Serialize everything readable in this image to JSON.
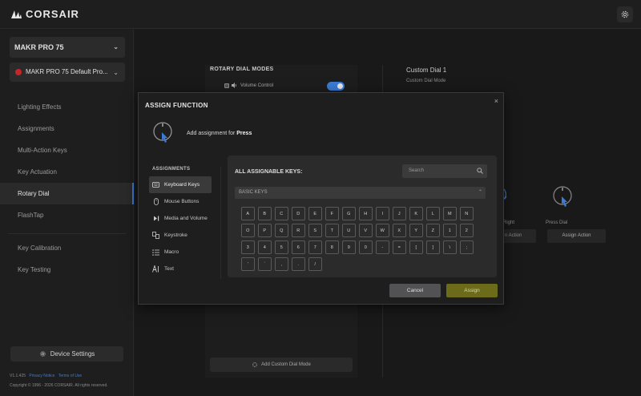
{
  "brand": {
    "name": "CORSAIR"
  },
  "sidebar": {
    "device": "MAKR PRO 75",
    "profile": "MAKR PRO 75 Default Pro...",
    "items": [
      {
        "label": "Lighting Effects",
        "active": false
      },
      {
        "label": "Assignments",
        "active": false
      },
      {
        "label": "Multi-Action Keys",
        "active": false
      },
      {
        "label": "Key Actuation",
        "active": false
      },
      {
        "label": "Rotary Dial",
        "active": true
      },
      {
        "label": "FlashTap",
        "active": false
      }
    ],
    "items2": [
      {
        "label": "Key Calibration"
      },
      {
        "label": "Key Testing"
      }
    ],
    "device_settings": "Device Settings",
    "version": "V1.1.425",
    "privacy": "Privacy Notice",
    "terms": "Terms of Use",
    "copyright": "Copyright © 1996 - 2026 CORSAIR. All rights reserved."
  },
  "main": {
    "rotary_title": "ROTARY DIAL MODES",
    "volume_control": "Volume Control",
    "volume_toggle_on": true,
    "custom_dial_title": "Custom Dial 1",
    "custom_dial_mode": "Custom Dial Mode",
    "right_label": "Right",
    "right_action": "n Action",
    "press_dial_label": "Press Dial",
    "press_dial_action": "Assign Action",
    "add_custom_mode": "Add Custom Dial Mode"
  },
  "modal": {
    "title": "ASSIGN FUNCTION",
    "close": "×",
    "assign_for_prefix": "Add assignment for ",
    "assign_for_target": "Press",
    "assignments_heading": "ASSIGNMENTS",
    "types": [
      {
        "label": "Keyboard Keys",
        "icon": "keyboard-icon",
        "active": true
      },
      {
        "label": "Mouse Buttons",
        "icon": "mouse-icon",
        "active": false
      },
      {
        "label": "Media and Volume",
        "icon": "media-icon",
        "active": false
      },
      {
        "label": "Keystroke",
        "icon": "keystroke-icon",
        "active": false
      },
      {
        "label": "Macro",
        "icon": "macro-icon",
        "active": false
      },
      {
        "label": "Text",
        "icon": "text-icon",
        "active": false
      }
    ],
    "keys_title": "ALL ASSIGNABLE KEYS:",
    "search_placeholder": "Search",
    "basic_keys": "BASIC KEYS",
    "key_rows": [
      [
        "A",
        "B",
        "C",
        "D",
        "E",
        "F",
        "G",
        "H",
        "I",
        "J",
        "K",
        "L",
        "M",
        "N"
      ],
      [
        "O",
        "P",
        "Q",
        "R",
        "S",
        "T",
        "U",
        "V",
        "W",
        "X",
        "Y",
        "Z",
        "1",
        "2"
      ],
      [
        "3",
        "4",
        "5",
        "6",
        "7",
        "8",
        "9",
        "0",
        "-",
        "=",
        "[",
        "]",
        "\\",
        ";"
      ],
      [
        "'",
        "`",
        ",",
        ".",
        "/"
      ]
    ],
    "cancel": "Cancel",
    "assign": "Assign"
  },
  "colors": {
    "accent_blue": "#3c7bd6",
    "assign_olive": "#6c6b1a",
    "profile_red": "#c8252a"
  }
}
